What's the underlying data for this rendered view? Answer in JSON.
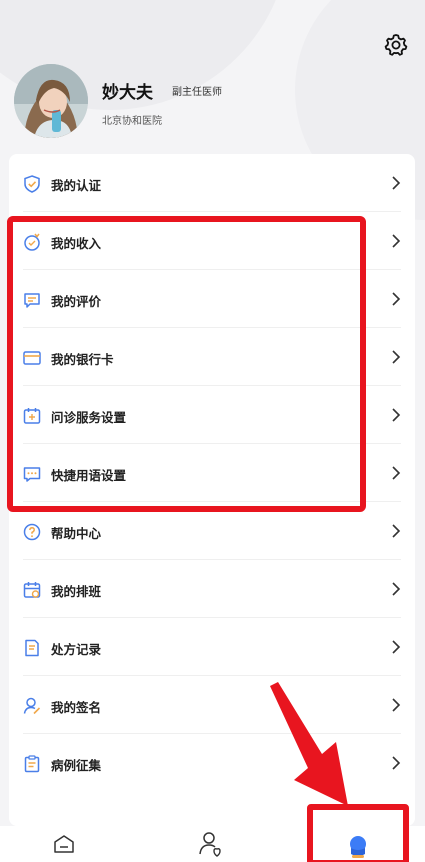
{
  "header": {
    "settings_icon": "gear-icon"
  },
  "profile": {
    "name": "妙大夫",
    "title": "副主任医师",
    "hospital": "北京协和医院"
  },
  "menu": {
    "items": [
      {
        "label": "我的认证",
        "icon": "shield-check-icon"
      },
      {
        "label": "我的收入",
        "icon": "income-icon"
      },
      {
        "label": "我的评价",
        "icon": "comment-icon"
      },
      {
        "label": "我的银行卡",
        "icon": "bank-card-icon"
      },
      {
        "label": "问诊服务设置",
        "icon": "calendar-plus-icon"
      },
      {
        "label": "快捷用语设置",
        "icon": "chat-dots-icon"
      },
      {
        "label": "帮助中心",
        "icon": "help-icon"
      },
      {
        "label": "我的排班",
        "icon": "schedule-icon"
      },
      {
        "label": "处方记录",
        "icon": "prescription-icon"
      },
      {
        "label": "我的签名",
        "icon": "signature-icon"
      },
      {
        "label": "病例征集",
        "icon": "clipboard-icon"
      }
    ]
  },
  "tabbar": {
    "tabs": [
      {
        "icon": "home-icon"
      },
      {
        "icon": "patients-icon"
      },
      {
        "icon": "profile-icon",
        "active": true
      }
    ],
    "active_color": "#3c7cf6"
  },
  "annotations": {
    "highlight_color": "#e8151f"
  }
}
